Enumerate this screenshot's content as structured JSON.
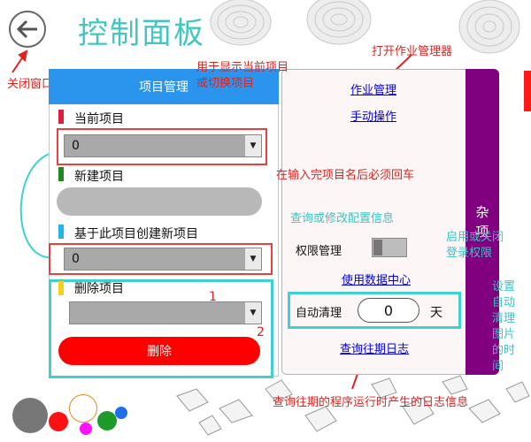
{
  "header": {
    "title": "控制面板",
    "close_annotation": "关闭窗口"
  },
  "project_panel": {
    "title": "项目管理",
    "current_project_label": "当前项目",
    "current_project_value": "0",
    "new_project_label": "新建项目",
    "new_project_value": "",
    "based_on_label": "基于此项目创建新项目",
    "based_on_value": "0",
    "delete_label": "删除项目",
    "delete_select_value": "",
    "delete_button": "删除",
    "marker_colors": [
      "#e0203a",
      "#1c8a1c",
      "#1fb7e8",
      "#f2d21c"
    ]
  },
  "right_panel": {
    "job_manager_link": "作业管理",
    "manual_link": "手动操作",
    "permission_label": "权限管理",
    "data_center_link": "使用数据中心",
    "auto_clean_label": "自动清理",
    "auto_clean_value": "0",
    "days_unit": "天",
    "log_link": "查询往期日志",
    "side_label_chars": [
      "杂",
      "项"
    ]
  },
  "annotations": {
    "switch_project": "用于显示当前项目\n或切换项目",
    "open_job_manager": "打开作业管理器",
    "enter_after_name": "在输入完项目名后必须回车",
    "config_info": "查询或修改配置信息",
    "toggle_permission": "启用或关闭\n登录权限",
    "auto_clean_time": "设置\n自动\n清理\n图片\n的时\n间",
    "num_1": "1",
    "num_2": "2",
    "log_info": "查询往期的程序运行时产生的日志信息"
  },
  "colors": {
    "accent_teal": "#41c7c0",
    "header_blue": "#2b95ee",
    "purple": "#800080",
    "annotation_red": "#e0231f",
    "highlight_teal": "#3fd0d0",
    "delete_red": "#ff0000"
  },
  "icons": [
    "back-arrow-icon",
    "dropdown-arrow-icon",
    "crystal-decoration",
    "wood-ring-decoration",
    "color-circle"
  ]
}
